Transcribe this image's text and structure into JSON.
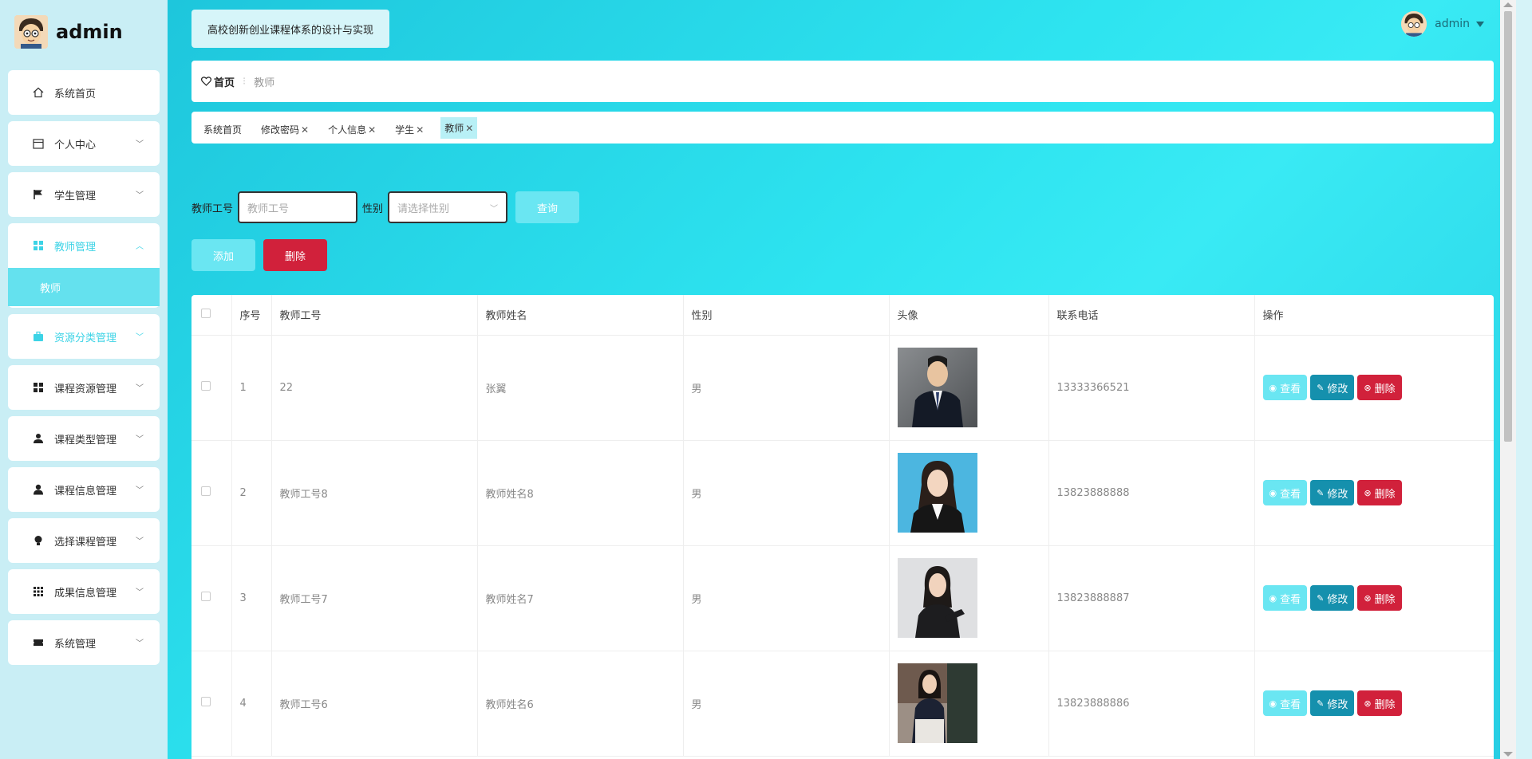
{
  "sidebar": {
    "brand": "admin",
    "items": [
      {
        "label": "系统首页",
        "icon": "home-icon"
      },
      {
        "label": "个人中心",
        "icon": "calendar-icon"
      },
      {
        "label": "学生管理",
        "icon": "flag-icon"
      },
      {
        "label": "教师管理",
        "icon": "grid-icon",
        "expanded": true,
        "sub": "教师"
      },
      {
        "label": "资源分类管理",
        "icon": "briefcase-icon"
      },
      {
        "label": "课程资源管理",
        "icon": "grid-icon"
      },
      {
        "label": "课程类型管理",
        "icon": "user-tie-icon"
      },
      {
        "label": "课程信息管理",
        "icon": "user-icon"
      },
      {
        "label": "选择课程管理",
        "icon": "bulb-icon"
      },
      {
        "label": "成果信息管理",
        "icon": "apps-icon"
      },
      {
        "label": "系统管理",
        "icon": "ticket-icon"
      }
    ]
  },
  "header": {
    "system_title": "高校创新创业课程体系的设计与实现",
    "user": "admin"
  },
  "breadcrumb": {
    "home": "首页",
    "current": "教师"
  },
  "tags": [
    {
      "label": "系统首页",
      "closable": false
    },
    {
      "label": "修改密码",
      "closable": true
    },
    {
      "label": "个人信息",
      "closable": true
    },
    {
      "label": "学生",
      "closable": true
    },
    {
      "label": "教师",
      "closable": true,
      "active": true
    }
  ],
  "search": {
    "id_label": "教师工号",
    "id_placeholder": "教师工号",
    "gender_label": "性别",
    "gender_placeholder": "请选择性别",
    "query_button": "查询"
  },
  "actions": {
    "add": "添加",
    "delete": "删除"
  },
  "table": {
    "headers": [
      "序号",
      "教师工号",
      "教师姓名",
      "性别",
      "头像",
      "联系电话",
      "操作"
    ],
    "op_labels": {
      "view": "查看",
      "edit": "修改",
      "delete": "删除"
    },
    "rows": [
      {
        "index": "1",
        "id": "22",
        "name": "张翼",
        "gender": "男",
        "phone": "13333366521"
      },
      {
        "index": "2",
        "id": "教师工号8",
        "name": "教师姓名8",
        "gender": "男",
        "phone": "13823888888"
      },
      {
        "index": "3",
        "id": "教师工号7",
        "name": "教师姓名7",
        "gender": "男",
        "phone": "13823888887"
      },
      {
        "index": "4",
        "id": "教师工号6",
        "name": "教师姓名6",
        "gender": "男",
        "phone": "13823888886"
      }
    ]
  },
  "colors": {
    "accent": "#3cd3e6",
    "danger": "#d1213b",
    "edit": "#1590ad"
  }
}
